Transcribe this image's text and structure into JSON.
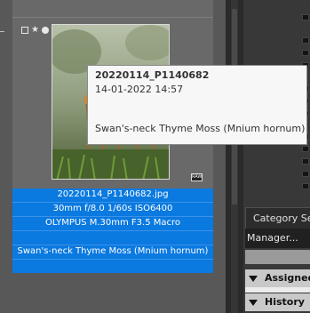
{
  "thumbnail": {
    "file_name": "20220114_P1140682.jpg",
    "exposure": "30mm f/8.0 1/60s ISO6400",
    "lens": "OLYMPUS M.30mm F3.5 Macro",
    "caption": "Swan's-neck Thyme Moss (Mnium hornum)",
    "flags": [
      "checkbox-icon",
      "star-icon",
      "circle-icon"
    ],
    "badge_icon": "raw-file-icon"
  },
  "tooltip": {
    "title": "20220114_P1140682",
    "date": "14-01-2022 14:57",
    "caption": "Swan's-neck Thyme Moss (Mnium hornum)"
  },
  "right_panel": {
    "category_tab": "Category Se",
    "manager_label": "Manager...",
    "sections": [
      {
        "label": "Assigned"
      },
      {
        "label": "History"
      }
    ]
  },
  "colors": {
    "selection": "#0a79e0",
    "tooltip_bg": "#f7f7f7",
    "panel_bg": "#383838"
  }
}
